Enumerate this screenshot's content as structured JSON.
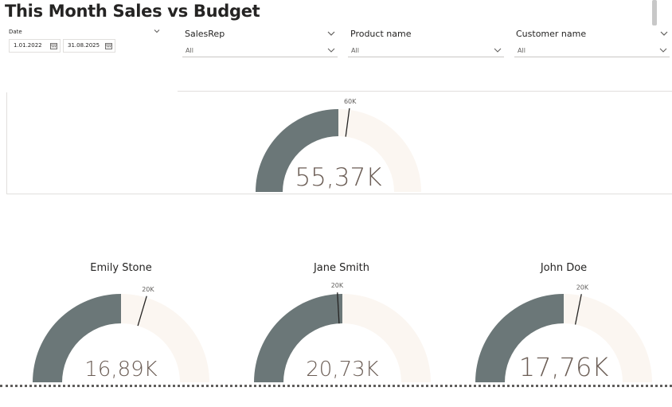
{
  "page": {
    "title": "This Month Sales vs Budget"
  },
  "date_slicer": {
    "label": "Date",
    "start": "1.01.2022",
    "end": "31.08.2025"
  },
  "slicers": [
    {
      "title": "SalesRep",
      "selected": "All"
    },
    {
      "title": "Product name",
      "selected": "All"
    },
    {
      "title": "Customer name",
      "selected": "All"
    }
  ],
  "colors": {
    "gauge_fill": "#6b7778",
    "gauge_track": "#fbf6f1",
    "value_text": "#6b5d55",
    "target_line": "#252423"
  },
  "chart_data": [
    {
      "type": "gauge",
      "title": "",
      "value": 55.37,
      "value_label": "55,37K",
      "target": 60,
      "target_label": "60K",
      "min": 0,
      "max": 110.74
    },
    {
      "type": "gauge",
      "title": "Emily Stone",
      "value": 16.89,
      "value_label": "16,89K",
      "target": 20,
      "target_label": "20K",
      "min": 0,
      "max": 33.78
    },
    {
      "type": "gauge",
      "title": "Jane Smith",
      "value": 20.73,
      "value_label": "20,73K",
      "target": 20,
      "target_label": "20K",
      "min": 0,
      "max": 41.46
    },
    {
      "type": "gauge",
      "title": "John Doe",
      "value": 17.76,
      "value_label": "17,76K",
      "target": 20,
      "target_label": "20K",
      "min": 0,
      "max": 35.52
    }
  ]
}
